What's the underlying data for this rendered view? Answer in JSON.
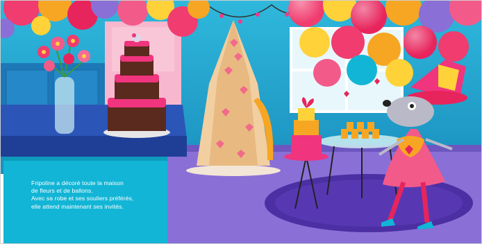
{
  "illustration": {
    "character": "mouse-in-pink-dress",
    "colors": {
      "wall": "#1fa6c9",
      "floor": "#8a6fd6",
      "rug": "#4b2fa3",
      "counter": "#2c55b8",
      "text_panel": "#12b5d6",
      "cake_pink": "#f0347e",
      "cake_chocolate": "#5a2a1e",
      "tower_cream": "#f2cfa0"
    }
  },
  "caption": {
    "line1": "Fripoline a décoré toute la maison",
    "line2": "de fleurs et de ballons.",
    "line3": "Avec sa robe et ses souliers préférés,",
    "line4": "elle attend maintenant ses invités."
  }
}
